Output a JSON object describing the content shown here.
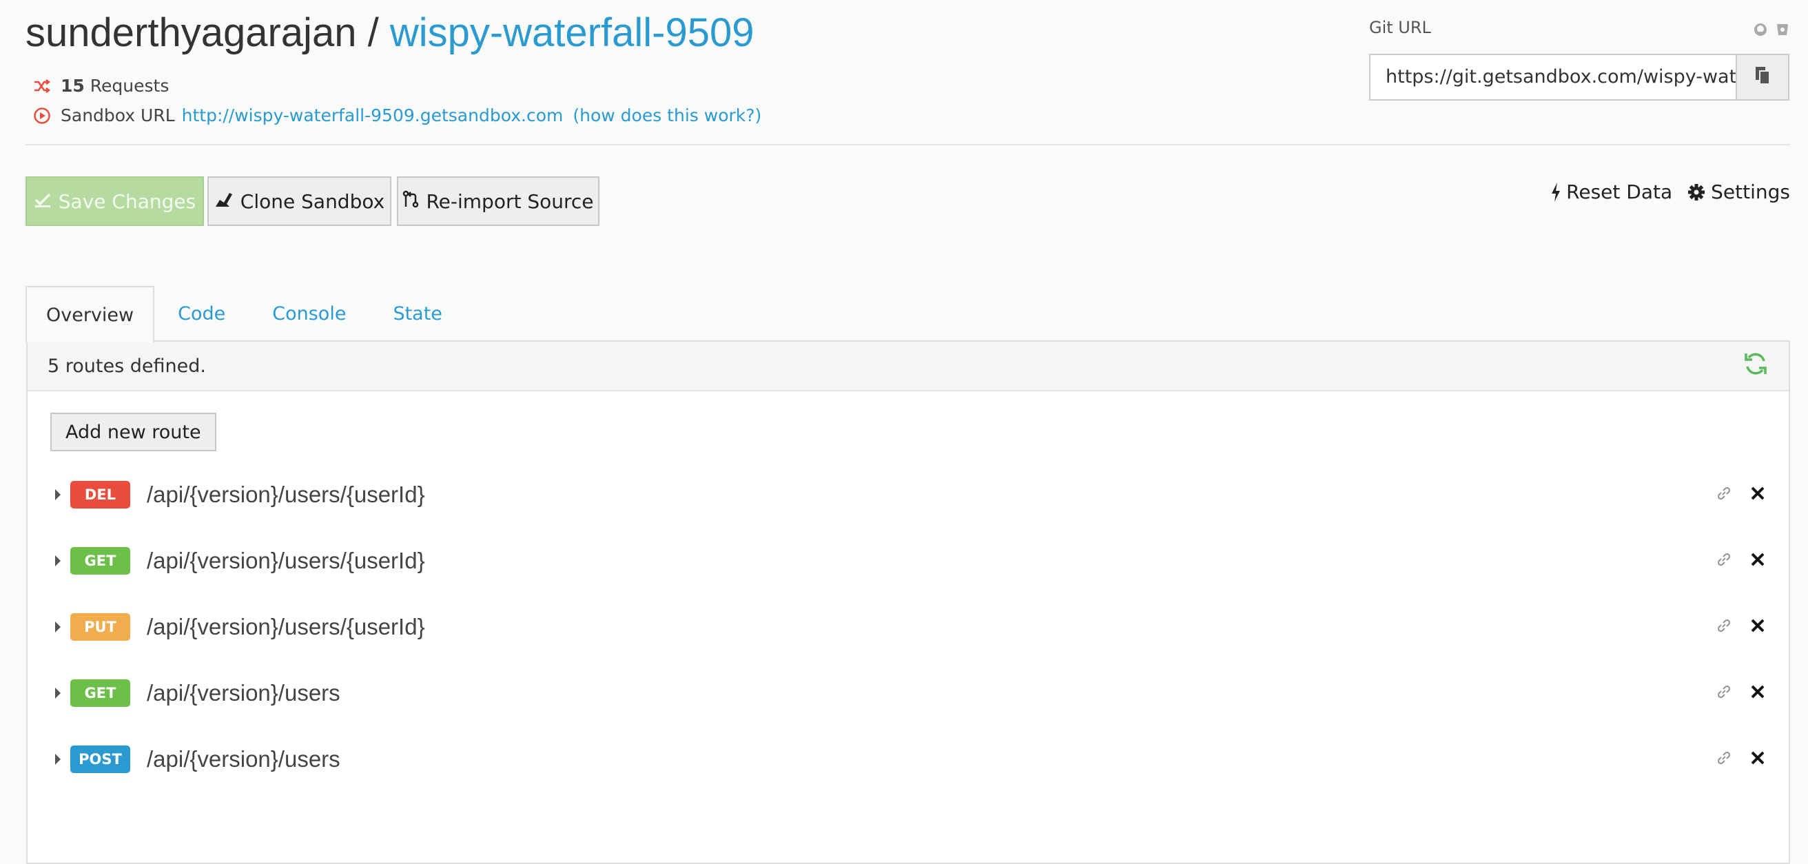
{
  "header": {
    "owner": "sunderthyagarajan",
    "separator": " / ",
    "repo": "wispy-waterfall-9509",
    "requests_count": "15",
    "requests_label": "Requests",
    "sandbox_url_label": "Sandbox URL",
    "sandbox_url": "http://wispy-waterfall-9509.getsandbox.com",
    "how_link": "(how does this work?)"
  },
  "git": {
    "label": "Git URL",
    "url": "https://git.getsandbox.com/wispy-water"
  },
  "toolbar": {
    "save_label": "Save Changes",
    "clone_label": "Clone Sandbox",
    "reimport_label": "Re-import Source",
    "reset_label": "Reset Data",
    "settings_label": "Settings"
  },
  "tabs": [
    {
      "label": "Overview",
      "active": true
    },
    {
      "label": "Code"
    },
    {
      "label": "Console"
    },
    {
      "label": "State"
    }
  ],
  "overview": {
    "summary": "5 routes defined.",
    "add_route_label": "Add new route",
    "routes": [
      {
        "method": "DEL",
        "path": "/api/{version}/users/{userId}",
        "color": "#e74c3c"
      },
      {
        "method": "GET",
        "path": "/api/{version}/users/{userId}",
        "color": "#6cc04a"
      },
      {
        "method": "PUT",
        "path": "/api/{version}/users/{userId}",
        "color": "#f0ad4e"
      },
      {
        "method": "GET",
        "path": "/api/{version}/users",
        "color": "#6cc04a"
      },
      {
        "method": "POST",
        "path": "/api/{version}/users",
        "color": "#2b9ad1"
      }
    ]
  },
  "colors": {
    "accent": "#2b9ad1",
    "save_disabled": "#b5dba0",
    "refresh": "#5cb85c"
  },
  "icons": {
    "requests": "shuffle-icon",
    "sandbox_url": "play-circle-icon",
    "copy": "copy-icon",
    "github": "github-icon",
    "bitbucket": "bitbucket-icon",
    "refresh": "refresh-icon",
    "link": "link-icon",
    "delete": "close-icon"
  }
}
